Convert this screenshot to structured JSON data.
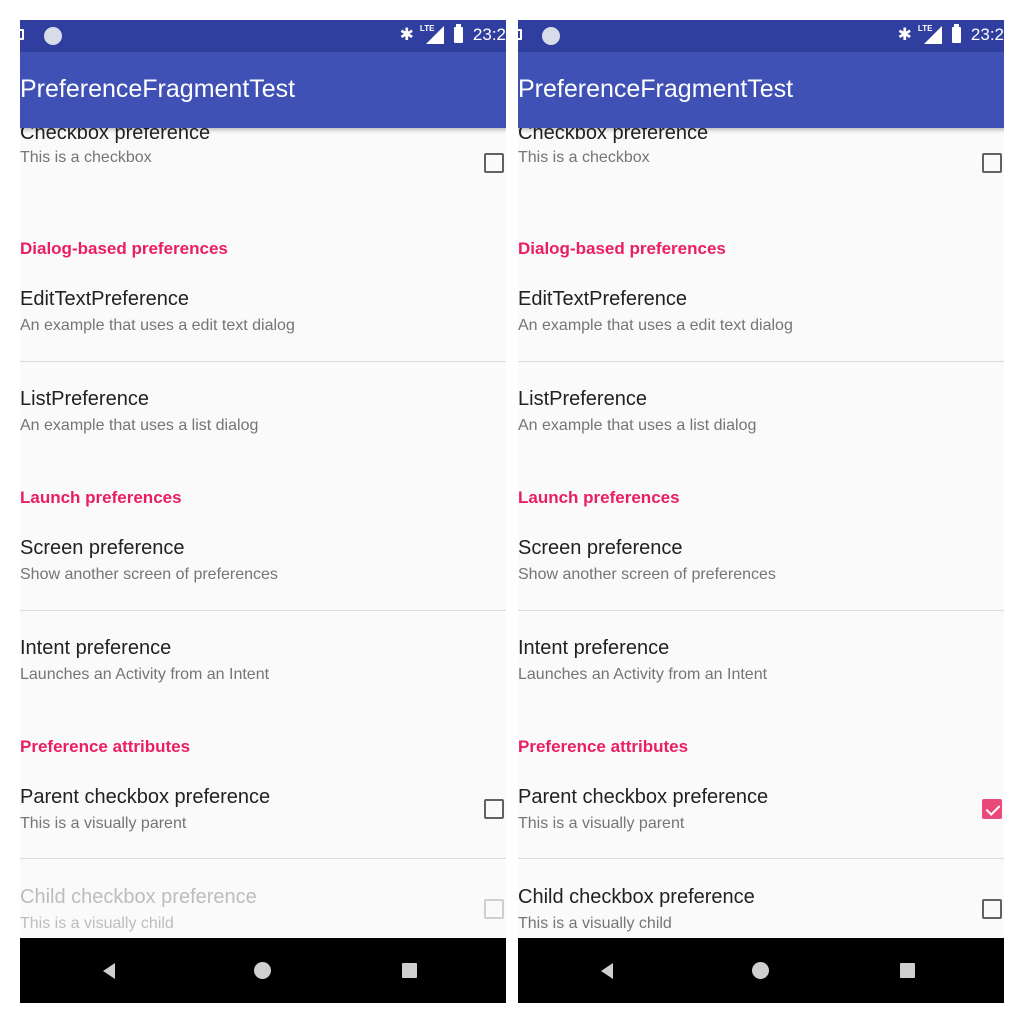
{
  "status_bar": {
    "time": "23:2",
    "lte_label": "LTE"
  },
  "app_bar": {
    "title": "PreferenceFragmentTest"
  },
  "items": {
    "checkbox_pref": {
      "title": "Checkbox preference",
      "summary": "This is a checkbox"
    },
    "dialog_category": "Dialog-based preferences",
    "edittext_pref": {
      "title": "EditTextPreference",
      "summary": "An example that uses a edit text dialog"
    },
    "list_pref": {
      "title": "ListPreference",
      "summary": "An example that uses a list dialog"
    },
    "launch_category": "Launch preferences",
    "screen_pref": {
      "title": "Screen preference",
      "summary": "Show another screen of preferences"
    },
    "intent_pref": {
      "title": "Intent preference",
      "summary": "Launches an Activity from an Intent"
    },
    "attributes_category": "Preference attributes",
    "parent_pref": {
      "title": "Parent checkbox preference",
      "summary": "This is a visually parent"
    },
    "child_pref": {
      "title": "Child checkbox preference",
      "summary": "This is a visually child"
    }
  },
  "left_state": {
    "parent_checked": false,
    "child_enabled": false
  },
  "right_state": {
    "parent_checked": true,
    "child_enabled": true
  },
  "colors": {
    "status_bar": "#303f9f",
    "app_bar": "#3f51b5",
    "accent": "#e91e63"
  },
  "icons": [
    "picture-icon",
    "notification-dot-icon",
    "bluetooth-icon",
    "lte-signal-icon",
    "battery-icon",
    "back-icon",
    "home-icon",
    "recents-icon"
  ]
}
